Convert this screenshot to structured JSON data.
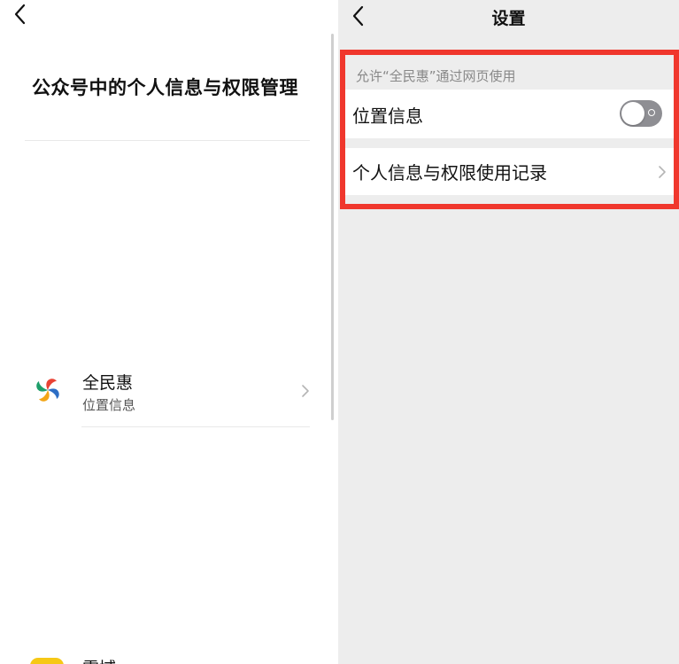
{
  "left": {
    "title": "公众号中的个人信息与权限管理",
    "apps": [
      {
        "name": "全民惠",
        "permission": "位置信息",
        "logo": "quanminhui-logo"
      },
      {
        "name": "雷域",
        "logo": "yellow-app-logo"
      }
    ]
  },
  "right": {
    "header_title": "设置",
    "section_caption": "允许“全民惠”通过网页使用",
    "location_row": {
      "label": "位置信息",
      "toggle_on": false
    },
    "records_row": {
      "label": "个人信息与权限使用记录"
    }
  },
  "colors": {
    "highlight": "#f0372d",
    "toggle_off": "#8e8e93",
    "right_background": "#ededed"
  },
  "icons": [
    "back-chevron-icon",
    "chevron-right-icon",
    "toggle-switch"
  ]
}
